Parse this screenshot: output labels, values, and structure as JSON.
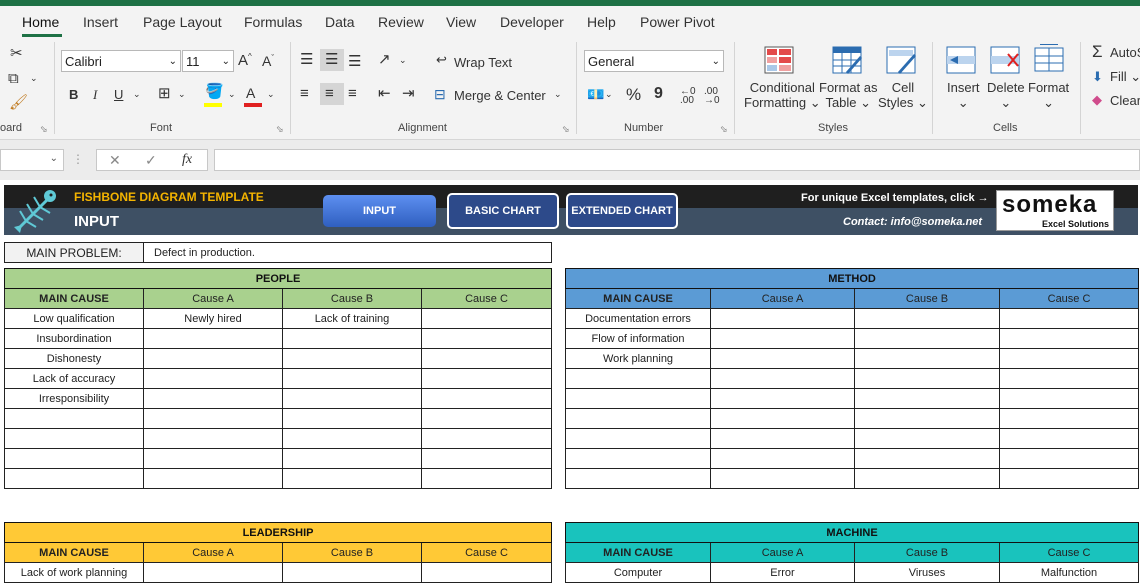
{
  "ribbon_tabs": [
    "Home",
    "Insert",
    "Page Layout",
    "Formulas",
    "Data",
    "Review",
    "View",
    "Developer",
    "Help",
    "Power Pivot"
  ],
  "clipboard": {
    "group_label": "oard"
  },
  "font": {
    "name": "Calibri",
    "size": "11",
    "group_label": "Font",
    "grow": "A",
    "shrink": "A",
    "bold": "B",
    "italic": "I",
    "underline": "U",
    "font_color_letter": "A"
  },
  "alignment": {
    "wrap_text": "Wrap Text",
    "merge_center": "Merge & Center",
    "group_label": "Alignment"
  },
  "number": {
    "format": "General",
    "group_label": "Number",
    "percent": "%",
    "comma": "9"
  },
  "styles": {
    "conditional_1": "Conditional",
    "conditional_2": "Formatting",
    "format_as_1": "Format as",
    "format_as_2": "Table",
    "cell_styles_1": "Cell",
    "cell_styles_2": "Styles",
    "group_label": "Styles"
  },
  "cells": {
    "insert": "Insert",
    "delete": "Delete",
    "format": "Format",
    "group_label": "Cells"
  },
  "editing": {
    "autosum": "AutoS",
    "fill": "Fill",
    "clear": "Clear"
  },
  "formula_bar": {
    "fx": "fx",
    "cancel": "✕",
    "enter": "✓"
  },
  "banner": {
    "title": "FISHBONE DIAGRAM TEMPLATE",
    "subtitle": "INPUT",
    "btn_input": "INPUT",
    "btn_basic": "BASIC CHART",
    "btn_extended": "EXTENDED CHART",
    "promo": "For unique Excel templates, click →",
    "contact": "Contact: info@someka.net",
    "logo_name": "someka",
    "logo_sub": "Excel Solutions"
  },
  "main_problem": {
    "label": "MAIN PROBLEM:",
    "value": "Defect in production."
  },
  "headers": {
    "main_cause": "MAIN CAUSE",
    "cause_a": "Cause A",
    "cause_b": "Cause B",
    "cause_c": "Cause C"
  },
  "people": {
    "title": "PEOPLE",
    "color": "#a9d18e",
    "rows": [
      [
        "Low qualification",
        "Newly hired",
        "Lack of training",
        ""
      ],
      [
        "Insubordination",
        "",
        "",
        ""
      ],
      [
        "Dishonesty",
        "",
        "",
        ""
      ],
      [
        "Lack of accuracy",
        "",
        "",
        ""
      ],
      [
        "Irresponsibility",
        "",
        "",
        ""
      ],
      [
        "",
        "",
        "",
        ""
      ],
      [
        "",
        "",
        "",
        ""
      ],
      [
        "",
        "",
        "",
        ""
      ],
      [
        "",
        "",
        "",
        ""
      ]
    ]
  },
  "method": {
    "title": "METHOD",
    "color": "#5b9bd5",
    "rows": [
      [
        "Documentation errors",
        "",
        "",
        ""
      ],
      [
        "Flow of information",
        "",
        "",
        ""
      ],
      [
        "Work planning",
        "",
        "",
        ""
      ],
      [
        "",
        "",
        "",
        ""
      ],
      [
        "",
        "",
        "",
        ""
      ],
      [
        "",
        "",
        "",
        ""
      ],
      [
        "",
        "",
        "",
        ""
      ],
      [
        "",
        "",
        "",
        ""
      ],
      [
        "",
        "",
        "",
        ""
      ]
    ]
  },
  "leadership": {
    "title": "LEADERSHIP",
    "color": "#ffc936",
    "rows": [
      [
        "Lack of work planning",
        "",
        "",
        ""
      ]
    ]
  },
  "machine": {
    "title": "MACHINE",
    "color": "#19c3bd",
    "rows": [
      [
        "Computer",
        "Error",
        "Viruses",
        "Malfunction"
      ]
    ]
  }
}
